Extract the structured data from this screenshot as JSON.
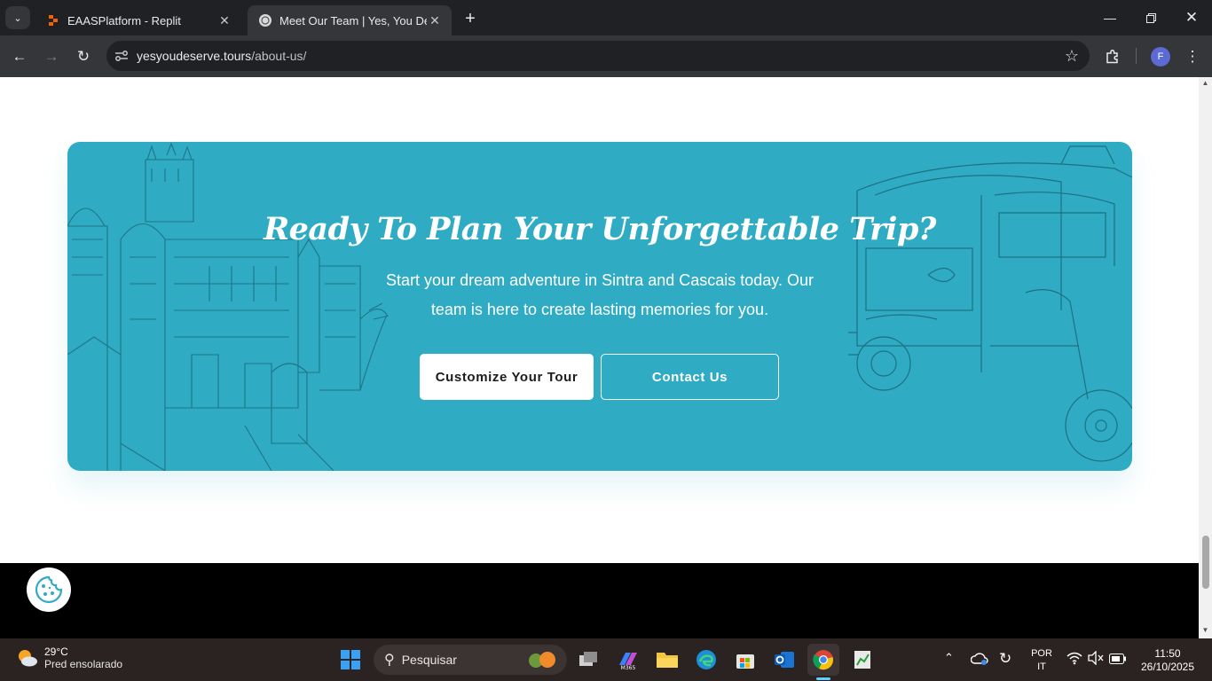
{
  "browser": {
    "tabs": [
      {
        "title": "EAASPlatform - Replit",
        "active": false
      },
      {
        "title": "Meet Our Team | Yes, You Deserve",
        "active": true
      }
    ],
    "url_host": "yesyoudeserve.tours",
    "url_path": "/about-us/",
    "profile_initial": "F"
  },
  "cta": {
    "title": "Ready To Plan Your Unforgettable Trip?",
    "subtitle": "Start your dream adventure in Sintra and Cascais today. Our team is here to create lasting memories for you.",
    "primary_button": "Customize Your Tour",
    "secondary_button": "Contact Us",
    "background_color": "#2fabc3"
  },
  "taskbar": {
    "weather_temp": "29°C",
    "weather_desc": "Pred ensolarado",
    "search_placeholder": "Pesquisar",
    "lang_top": "POR",
    "lang_bottom": "IT",
    "time": "11:50",
    "date": "26/10/2025"
  }
}
